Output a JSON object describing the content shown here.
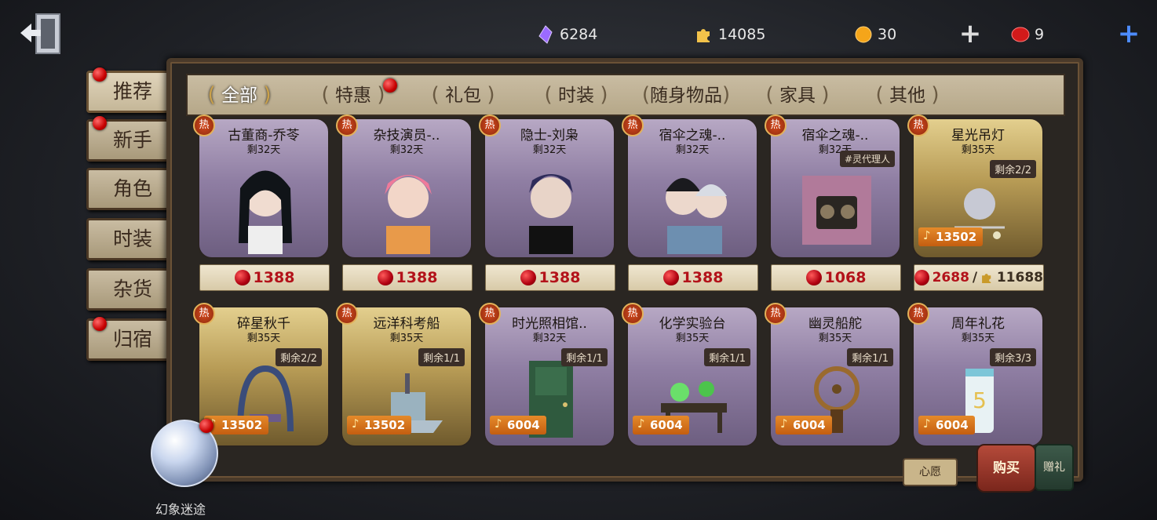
{
  "currencies": [
    {
      "icon": "purple-crystal-icon",
      "value": "6284",
      "color": "#9b6bff"
    },
    {
      "icon": "puzzle-piece-icon",
      "value": "14085",
      "color": "#f2c24a"
    },
    {
      "icon": "orange-coin-icon",
      "value": "30",
      "color": "#f5a51a"
    },
    {
      "icon": "red-gem-icon",
      "value": "9",
      "color": "#d21a1a"
    }
  ],
  "tabs": [
    "全部",
    "特惠",
    "礼包",
    "时装",
    "随身物品",
    "家具",
    "其他"
  ],
  "side": [
    "推荐",
    "新手",
    "角色",
    "时装",
    "杂货",
    "归宿"
  ],
  "hot_label": "热",
  "items": [
    {
      "name": "古董商-乔苓",
      "days": "剩32天",
      "price": "1388",
      "color": "purple",
      "figure": "girl"
    },
    {
      "name": "杂技演员-..",
      "days": "剩32天",
      "price": "1388",
      "color": "purple",
      "figure": "pink"
    },
    {
      "name": "隐士-刘枭",
      "days": "剩32天",
      "price": "1388",
      "color": "purple",
      "figure": "blue"
    },
    {
      "name": "宿伞之魂-..",
      "days": "剩32天",
      "price": "1388",
      "color": "purple",
      "figure": "duo"
    },
    {
      "name": "宿伞之魂-..",
      "days": "剩32天",
      "price": "1068",
      "color": "purple",
      "figure": "camera",
      "tag": "#灵代理人"
    },
    {
      "name": "星光吊灯",
      "days": "剩35天",
      "remain": "剩余2/2",
      "ticket": "13502",
      "price": "2688",
      "price2": "11688",
      "color": "gold",
      "figure": "lamp"
    },
    {
      "name": "碎星秋千",
      "days": "剩35天",
      "remain": "剩余2/2",
      "ticket": "13502",
      "color": "gold",
      "figure": "swing"
    },
    {
      "name": "远洋科考船",
      "days": "剩35天",
      "remain": "剩余1/1",
      "ticket": "13502",
      "color": "gold",
      "figure": "ship"
    },
    {
      "name": "时光照相馆..",
      "days": "剩32天",
      "remain": "剩余1/1",
      "ticket": "6004",
      "color": "purple",
      "figure": "door"
    },
    {
      "name": "化学实验台",
      "days": "剩35天",
      "remain": "剩余1/1",
      "ticket": "6004",
      "color": "purple",
      "figure": "lab"
    },
    {
      "name": "幽灵船舵",
      "days": "剩35天",
      "remain": "剩余1/1",
      "ticket": "6004",
      "color": "purple",
      "figure": "wheel"
    },
    {
      "name": "周年礼花",
      "days": "剩35天",
      "remain": "剩余3/3",
      "ticket": "6004",
      "color": "purple",
      "figure": "can"
    }
  ],
  "globe_label": "幻象迷途",
  "wish_label": "心愿",
  "buy_label": "购买",
  "gift_label": "赠礼"
}
